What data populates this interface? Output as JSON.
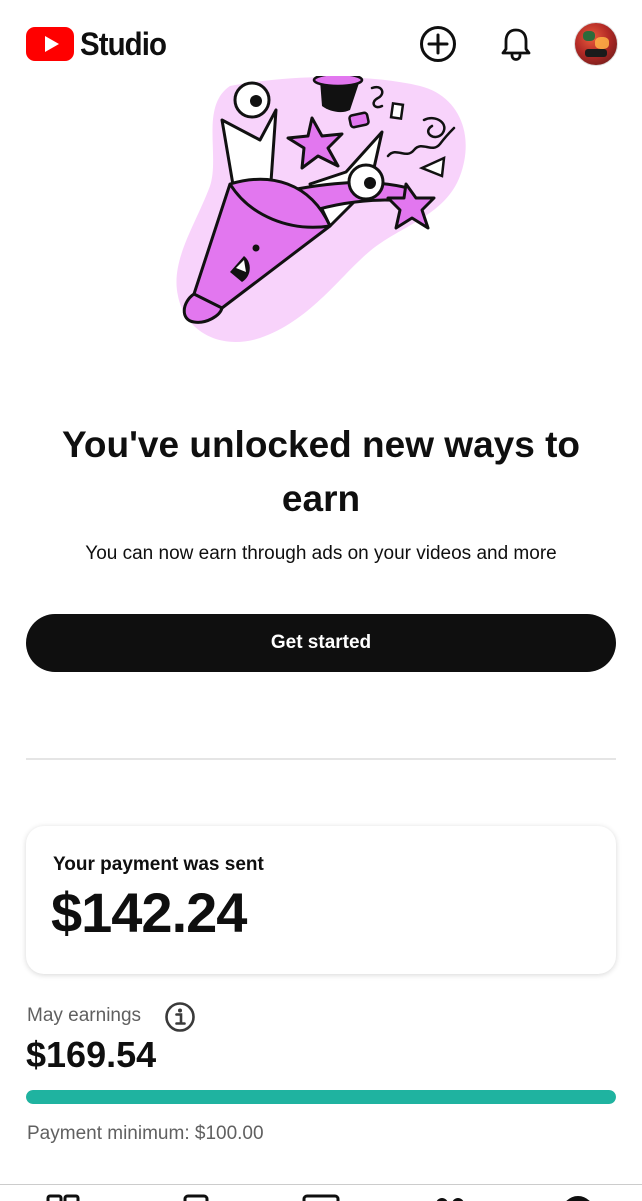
{
  "header": {
    "app_name": "Studio",
    "icons": [
      "youtube-play-icon",
      "create-icon",
      "notifications-bell-icon",
      "avatar"
    ],
    "brand_color": "#ff0000"
  },
  "promo": {
    "title": "You've unlocked new ways to earn",
    "subtitle": "You can now earn through ads on your videos and more",
    "button_label": "Get started",
    "illustration_accent": "#e277ef"
  },
  "payment": {
    "label": "Your payment was sent",
    "amount": "$142.24"
  },
  "earnings": {
    "label": "May earnings",
    "amount": "$169.54",
    "minimum_label": "Payment minimum: $100.00",
    "progress_fraction": 1.0,
    "progress_color": "#1fb3a0"
  },
  "bottom_nav": {
    "icons": [
      "dashboard-icon",
      "content-icon",
      "analytics-icon",
      "community-icon",
      "earn-icon"
    ]
  }
}
